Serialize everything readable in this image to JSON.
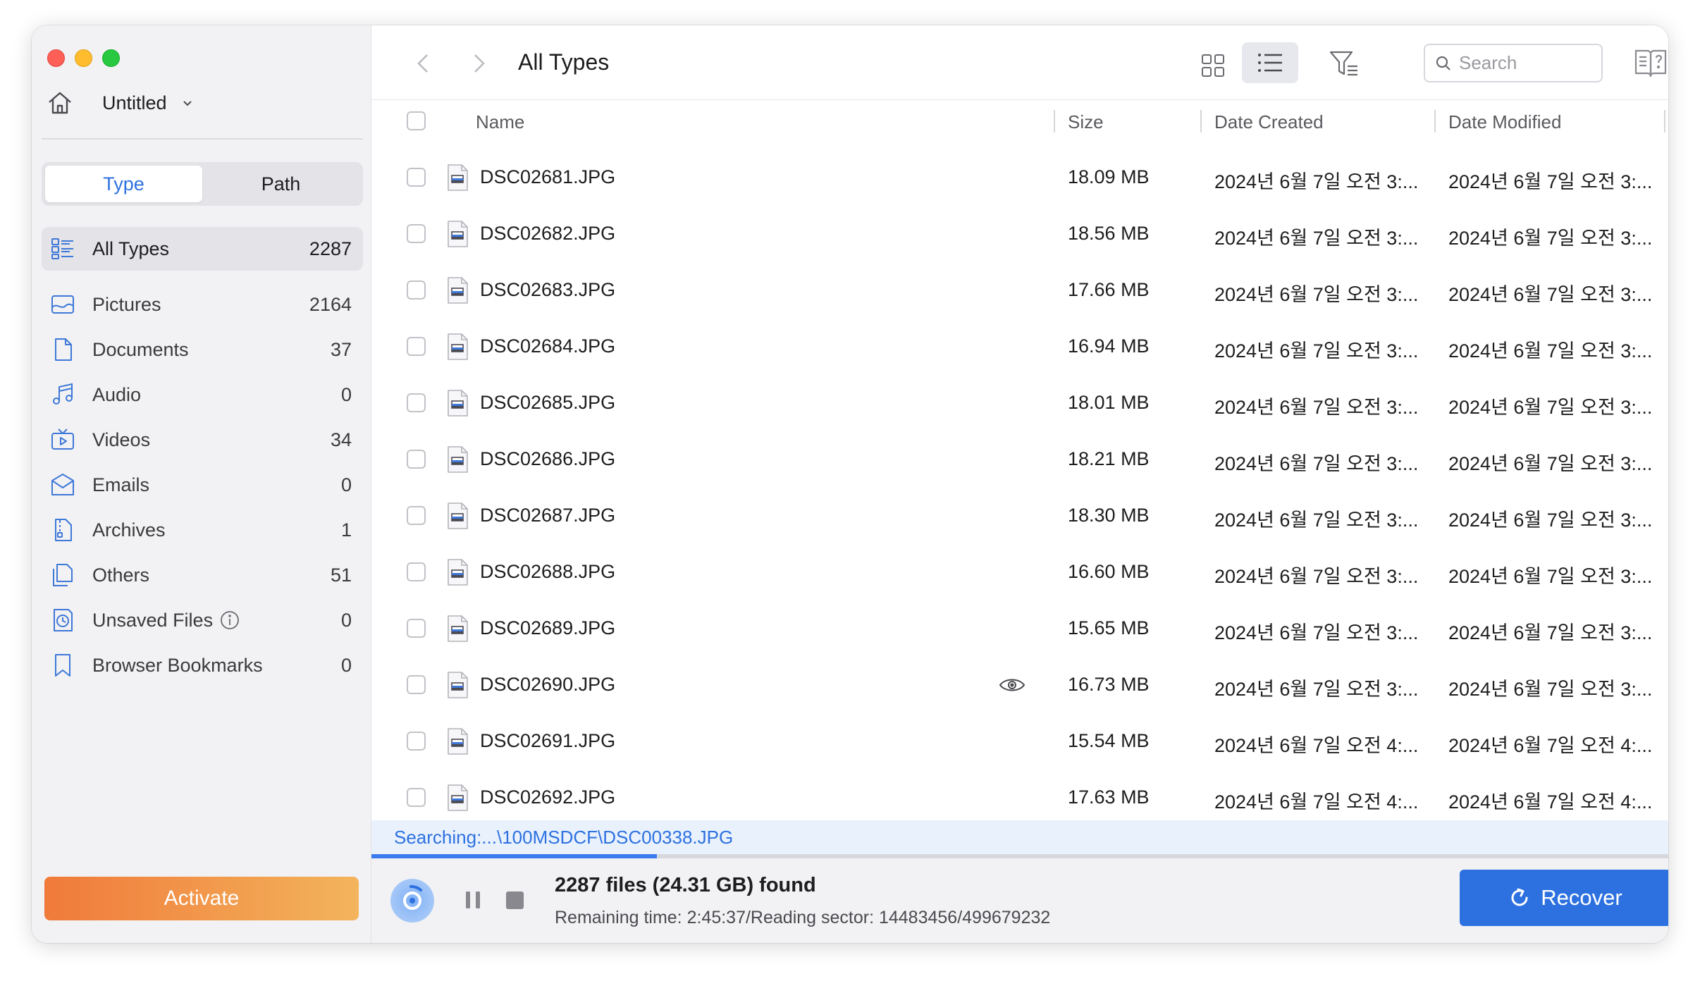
{
  "window": {
    "project_name": "Untitled"
  },
  "sidebar": {
    "segments": [
      {
        "label": "Type",
        "active": true
      },
      {
        "label": "Path",
        "active": false
      }
    ],
    "categories": [
      {
        "label": "All Types",
        "count": "2287",
        "icon": "all-types-icon",
        "selected": true
      },
      {
        "label": "Pictures",
        "count": "2164",
        "icon": "picture-icon"
      },
      {
        "label": "Documents",
        "count": "37",
        "icon": "document-icon"
      },
      {
        "label": "Audio",
        "count": "0",
        "icon": "music-note-icon"
      },
      {
        "label": "Videos",
        "count": "34",
        "icon": "video-icon"
      },
      {
        "label": "Emails",
        "count": "0",
        "icon": "email-icon"
      },
      {
        "label": "Archives",
        "count": "1",
        "icon": "archive-icon"
      },
      {
        "label": "Others",
        "count": "51",
        "icon": "others-icon"
      },
      {
        "label": "Unsaved Files",
        "count": "0",
        "icon": "clock-file-icon",
        "info": true
      },
      {
        "label": "Browser Bookmarks",
        "count": "0",
        "icon": "bookmark-icon"
      }
    ],
    "activate_label": "Activate"
  },
  "toolbar": {
    "title": "All Types",
    "search_placeholder": "Search"
  },
  "table": {
    "columns": {
      "name": "Name",
      "size": "Size",
      "created": "Date Created",
      "modified": "Date Modified"
    },
    "rows": [
      {
        "name": "DSC02681.JPG",
        "size": "18.09 MB",
        "created": "2024년 6월 7일 오전 3:...",
        "modified": "2024년 6월 7일 오전 3:..."
      },
      {
        "name": "DSC02682.JPG",
        "size": "18.56 MB",
        "created": "2024년 6월 7일 오전 3:...",
        "modified": "2024년 6월 7일 오전 3:..."
      },
      {
        "name": "DSC02683.JPG",
        "size": "17.66 MB",
        "created": "2024년 6월 7일 오전 3:...",
        "modified": "2024년 6월 7일 오전 3:..."
      },
      {
        "name": "DSC02684.JPG",
        "size": "16.94 MB",
        "created": "2024년 6월 7일 오전 3:...",
        "modified": "2024년 6월 7일 오전 3:..."
      },
      {
        "name": "DSC02685.JPG",
        "size": "18.01 MB",
        "created": "2024년 6월 7일 오전 3:...",
        "modified": "2024년 6월 7일 오전 3:..."
      },
      {
        "name": "DSC02686.JPG",
        "size": "18.21 MB",
        "created": "2024년 6월 7일 오전 3:...",
        "modified": "2024년 6월 7일 오전 3:..."
      },
      {
        "name": "DSC02687.JPG",
        "size": "18.30 MB",
        "created": "2024년 6월 7일 오전 3:...",
        "modified": "2024년 6월 7일 오전 3:..."
      },
      {
        "name": "DSC02688.JPG",
        "size": "16.60 MB",
        "created": "2024년 6월 7일 오전 3:...",
        "modified": "2024년 6월 7일 오전 3:..."
      },
      {
        "name": "DSC02689.JPG",
        "size": "15.65 MB",
        "created": "2024년 6월 7일 오전 3:...",
        "modified": "2024년 6월 7일 오전 3:..."
      },
      {
        "name": "DSC02690.JPG",
        "size": "16.73 MB",
        "created": "2024년 6월 7일 오전 3:...",
        "modified": "2024년 6월 7일 오전 3:...",
        "hover": true
      },
      {
        "name": "DSC02691.JPG",
        "size": "15.54 MB",
        "created": "2024년 6월 7일 오전 4:...",
        "modified": "2024년 6월 7일 오전 4:..."
      },
      {
        "name": "DSC02692.JPG",
        "size": "17.63 MB",
        "created": "2024년 6월 7일 오전 4:...",
        "modified": "2024년 6월 7일 오전 4:..."
      }
    ]
  },
  "status": {
    "searching": "Searching:...\\100MSDCF\\DSC00338.JPG",
    "progress_fraction": 0.22,
    "found": "2287 files (24.31 GB) found",
    "remaining": "Remaining time: 2:45:37/Reading sector: 14483456/499679232",
    "recover_label": "Recover"
  },
  "colors": {
    "accent": "#2d71e0",
    "icon_blue": "#3e78d8",
    "activate_start": "#f07a3a",
    "activate_end": "#f3b45c"
  }
}
